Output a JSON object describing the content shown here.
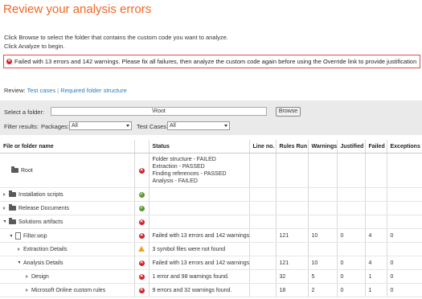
{
  "page": {
    "title": "Review your analysis errors",
    "intro_line1": "Click Browse to select the folder that contains the custom code you want to analyze.",
    "intro_line2": "Click Analyze to begin.",
    "error_message": "Failed with 13 errors and 142 warnings. Please fix all failures, then analyze the custom code again before using the Override link to provide justification"
  },
  "review": {
    "label": "Review:",
    "link1": "Test cases",
    "sep": "|",
    "link2": "Required folder structure"
  },
  "filters": {
    "folder_label": "Select a folder:",
    "folder_value": "\\Root",
    "browse_label": "Browse",
    "filter_label": "Filter results:",
    "packages_label": "Packages:",
    "packages_value": "All",
    "testcases_label": "Test Cases:",
    "testcases_value": "All"
  },
  "table": {
    "headers": [
      "File or folder name",
      "",
      "Status",
      "Line no.",
      "Rules Run",
      "Warnings",
      "Justified",
      "Failed",
      "Exceptions"
    ],
    "rows": [
      {
        "name": "Root",
        "indent": 0,
        "expander": "none",
        "icon": "folder",
        "status_icon": "error",
        "status_lines": [
          "Folder structure - FAILED",
          "Extraction - PASSED",
          "Finding references - PASSED",
          "Analysis - FAILED"
        ],
        "line": "",
        "rules": "",
        "warnings": "",
        "justified": "",
        "failed": "",
        "exceptions": ""
      },
      {
        "name": "Installation scripts",
        "indent": 0,
        "expander": "closed",
        "icon": "folder",
        "status_icon": "ok",
        "status_lines": [],
        "line": "",
        "rules": "",
        "warnings": "",
        "justified": "",
        "failed": "",
        "exceptions": ""
      },
      {
        "name": "Release Documents",
        "indent": 0,
        "expander": "closed",
        "icon": "folder",
        "status_icon": "ok",
        "status_lines": [],
        "line": "",
        "rules": "",
        "warnings": "",
        "justified": "",
        "failed": "",
        "exceptions": ""
      },
      {
        "name": "Solutions artifacts",
        "indent": 0,
        "expander": "open",
        "icon": "folder",
        "status_icon": "error",
        "status_lines": [],
        "line": "",
        "rules": "",
        "warnings": "",
        "justified": "",
        "failed": "",
        "exceptions": ""
      },
      {
        "name": "Filter.wsp",
        "indent": 1,
        "expander": "open",
        "icon": "file",
        "status_icon": "error",
        "status_lines": [
          "Failed with 13 errors and 142 warnings."
        ],
        "line": "",
        "rules": "121",
        "warnings": "10",
        "justified": "0",
        "failed": "4",
        "exceptions": "0"
      },
      {
        "name": "Extraction Details",
        "indent": 2,
        "expander": "closed",
        "icon": "none",
        "status_icon": "warning",
        "status_lines": [
          "3 symbol files were not found"
        ],
        "line": "",
        "rules": "",
        "warnings": "",
        "justified": "",
        "failed": "",
        "exceptions": ""
      },
      {
        "name": "Analysis Details",
        "indent": 2,
        "expander": "open",
        "icon": "none",
        "status_icon": "error",
        "status_lines": [
          "Failed with 13 errors and 142 warnings."
        ],
        "line": "",
        "rules": "121",
        "warnings": "10",
        "justified": "0",
        "failed": "4",
        "exceptions": "0"
      },
      {
        "name": "Design",
        "indent": 3,
        "expander": "closed",
        "icon": "none",
        "status_icon": "error",
        "status_lines": [
          "1 error  and 98 warnings found."
        ],
        "line": "",
        "rules": "32",
        "warnings": "5",
        "justified": "0",
        "failed": "1",
        "exceptions": "0"
      },
      {
        "name": "Microsoft Online custom rules",
        "indent": 3,
        "expander": "closed",
        "icon": "none",
        "status_icon": "error",
        "status_lines": [
          "9 errors  and 32 warnings found."
        ],
        "line": "",
        "rules": "18",
        "warnings": "2",
        "justified": "0",
        "failed": "1",
        "exceptions": "0"
      }
    ]
  }
}
